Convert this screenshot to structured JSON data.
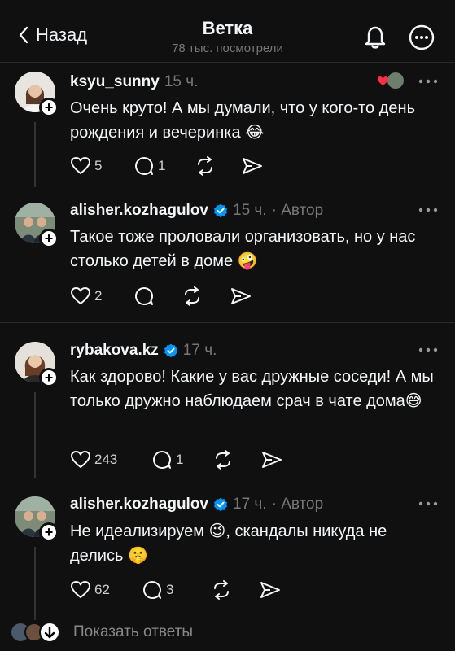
{
  "header": {
    "back_label": "Назад",
    "title": "Ветка",
    "views": "78 тыс. посмотрели"
  },
  "posts": [
    {
      "username": "ksyu_sunny",
      "time": "15 ч.",
      "author_tag": "",
      "text": "Очень круто! А мы думали, что у кого-то день рождения и вечеринка 😂",
      "likes": "5",
      "replies": "1"
    },
    {
      "username": "alisher.kozhagulov",
      "time": "15 ч.",
      "author_tag": "· Автор",
      "text": "Такое тоже проловали организовать, но у нас столько детей в доме 🤪",
      "likes": "2",
      "replies": ""
    },
    {
      "username": "rybakova.kz",
      "time": "17 ч.",
      "author_tag": "",
      "text": "Как здорово! Какие у вас дружные соседи! А мы только дружно наблюдаем срач в чате дома😅",
      "likes": "243",
      "replies": "1"
    },
    {
      "username": "alisher.kozhagulov",
      "time": "17 ч.",
      "author_tag": "· Автор",
      "text": "Не идеализируем 😉, скандалы никуда не делись 🤫",
      "likes": "62",
      "replies": "3"
    }
  ],
  "footer": {
    "show_replies": "Показать ответы"
  },
  "colors": {
    "background": "#101010",
    "text": "#f3f5f7",
    "muted": "#777777",
    "verified": "#0095f6",
    "like_heart": "#ff3040"
  }
}
